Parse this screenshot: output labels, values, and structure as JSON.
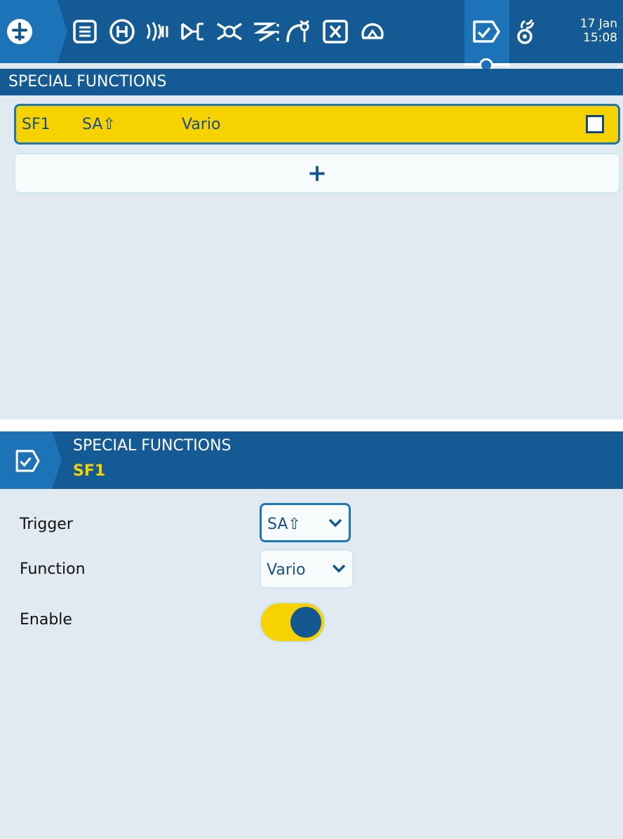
{
  "colors": {
    "header_blue": "#145a94",
    "tab_blue": "#1c73b8",
    "panel_bg": "#e0eaf0",
    "highlight_yellow": "#f5d200",
    "text_blue": "#17538a"
  },
  "topbar": {
    "tabs": [
      {
        "icon": "model-plane-icon"
      },
      {
        "icon": "model-setup-list-icon"
      },
      {
        "icon": "heli-icon"
      },
      {
        "icon": "flight-modes-icon"
      },
      {
        "icon": "inputs-icon"
      },
      {
        "icon": "mixer-icon"
      },
      {
        "icon": "outputs-icon"
      },
      {
        "icon": "curves-icon"
      },
      {
        "icon": "global-variables-icon"
      },
      {
        "icon": "logical-switches-icon"
      },
      {
        "icon": "special-functions-icon",
        "active": true
      },
      {
        "icon": "telemetry-icon"
      }
    ],
    "date": "17 Jan",
    "time": "15:08"
  },
  "list_screen": {
    "title": "SPECIAL FUNCTIONS",
    "rows": [
      {
        "id": "SF1",
        "trigger": "SA⇧",
        "function": "Vario",
        "active": false
      }
    ],
    "add_label": "+"
  },
  "edit_screen": {
    "title": "SPECIAL FUNCTIONS",
    "subtitle": "SF1",
    "fields": {
      "trigger": {
        "label": "Trigger",
        "value": "SA⇧"
      },
      "function": {
        "label": "Function",
        "value": "Vario"
      },
      "enable": {
        "label": "Enable",
        "value": true
      }
    }
  }
}
